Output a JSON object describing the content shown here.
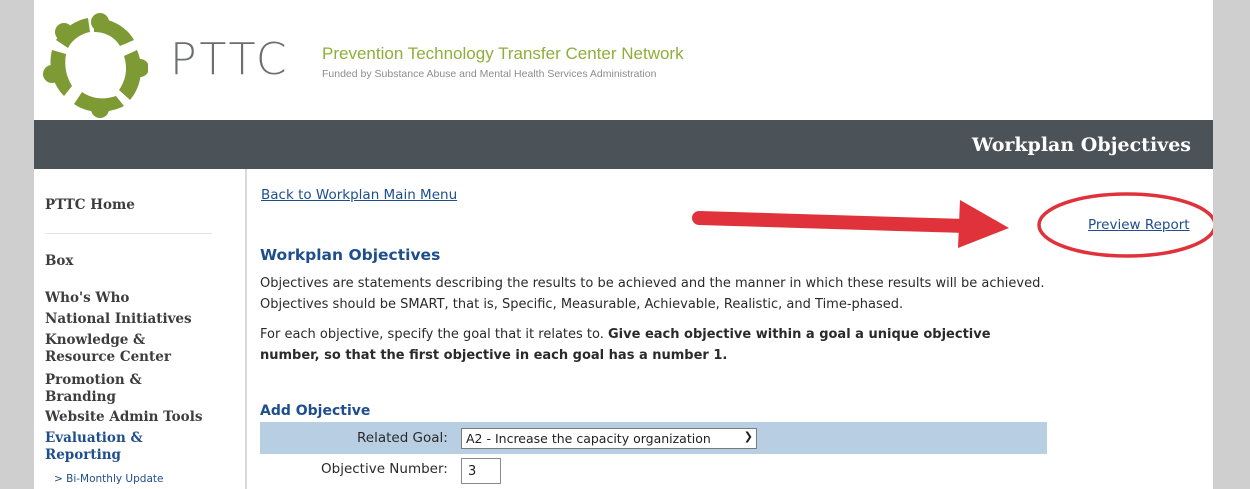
{
  "header": {
    "brand": "PTTC",
    "tagline": "Prevention Technology Transfer Center Network",
    "sub_tagline": "Funded by Substance Abuse and Mental Health Services Administration",
    "page_title": "Workplan Objectives"
  },
  "sidebar": {
    "items": [
      {
        "label": "PTTC Home"
      },
      {
        "label": "Box"
      },
      {
        "label": "Who's Who"
      },
      {
        "label": "National Initiatives"
      },
      {
        "label": "Knowledge & Resource Center"
      },
      {
        "label": "Promotion & Branding"
      },
      {
        "label": "Website Admin Tools"
      },
      {
        "label": "Evaluation & Reporting"
      }
    ],
    "sub_items": [
      {
        "label": "> Bi-Monthly Update"
      }
    ]
  },
  "main": {
    "back_link": "Back to Workplan Main Menu",
    "preview_link": "Preview Report",
    "section_title": "Workplan Objectives",
    "intro": "Objectives are statements describing the results to be achieved and the manner in which these results will be achieved. Objectives should be SMART, that is, Specific, Measurable, Achievable, Realistic, and Time-phased.",
    "instruction_plain": "For each objective, specify the goal that it relates to.",
    "instruction_bold": "Give each objective within a goal a unique objective number, so that the first objective in each goal has a number 1.",
    "add_title": "Add Objective",
    "related_goal_label": "Related Goal:",
    "related_goal_value": "A2 - Increase the capacity organization",
    "objective_number_label": "Objective Number:",
    "objective_number_value": "3"
  },
  "colors": {
    "title_bar": "#4b5258",
    "link": "#1f4e8c",
    "logo_green": "#7d9a35",
    "annotation_red": "#e0323a",
    "goal_row": "#b8cfe3"
  }
}
